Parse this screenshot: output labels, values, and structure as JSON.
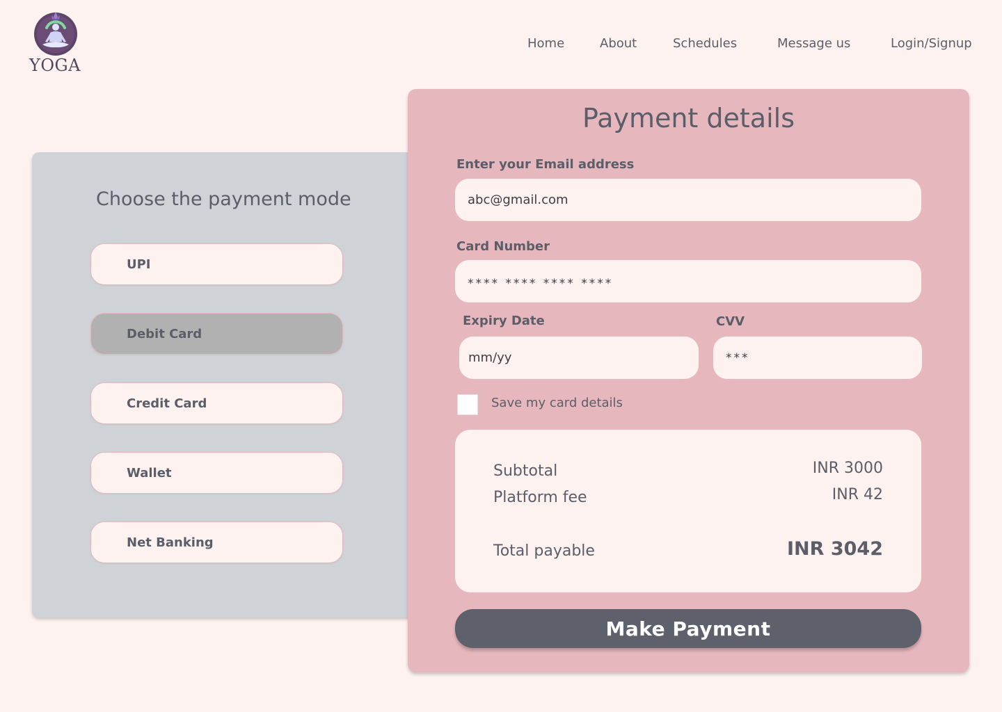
{
  "brand": {
    "name": "YOGA",
    "logo_icon": "meditation-figure-icon"
  },
  "nav": {
    "home": "Home",
    "about": "About",
    "schedules": "Schedules",
    "message": "Message us",
    "login": "Login/Signup"
  },
  "payment_modes": {
    "title": "Choose the payment mode",
    "selected": "Debit Card",
    "options": [
      "UPI",
      "Debit Card",
      "Credit Card",
      "Wallet",
      "Net Banking"
    ]
  },
  "payment_details": {
    "title": "Payment details",
    "email": {
      "label": "Enter your Email address",
      "value": "abc@gmail.com"
    },
    "card_number": {
      "label": "Card Number",
      "value": "**** **** **** ****"
    },
    "expiry": {
      "label": "Expiry Date",
      "placeholder": "mm/yy"
    },
    "cvv": {
      "label": "CVV",
      "value": "***"
    },
    "save_card": {
      "label": "Save my card details",
      "checked": false
    }
  },
  "summary": {
    "subtotal_label": "Subtotal",
    "subtotal_value": "INR 3000",
    "fee_label": "Platform fee",
    "fee_value": "INR 42",
    "total_label": "Total payable",
    "total_value": "INR 3042"
  },
  "actions": {
    "pay_label": "Make Payment"
  },
  "colors": {
    "page_bg": "#fdf2ef",
    "mode_panel_bg": "#cfd3d7",
    "pay_panel_bg": "#e6b8be",
    "selected_option": "#b1b1b1",
    "button_bg": "#5e616b"
  }
}
